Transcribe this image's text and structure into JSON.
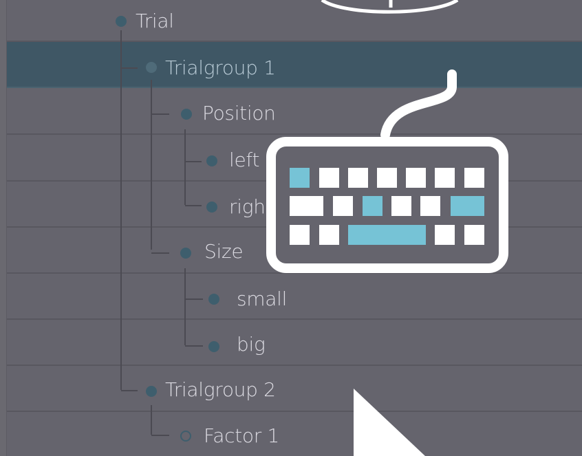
{
  "tree": {
    "nodes": [
      {
        "label": "Trial"
      },
      {
        "label": "Trialgroup 1"
      },
      {
        "label": "Position"
      },
      {
        "label": "left"
      },
      {
        "label": "righ"
      },
      {
        "label": "Size"
      },
      {
        "label": "small"
      },
      {
        "label": "big"
      },
      {
        "label": "Trialgroup 2"
      },
      {
        "label": "Factor 1"
      }
    ]
  },
  "overlay": {
    "icons": [
      "keyboard-icon",
      "mouse-pointer-icon",
      "circular-shape-icon"
    ]
  },
  "colors": {
    "background": "#65646d",
    "selected_row": "#3f5765",
    "node_dot": "#3e5e6d",
    "tree_text": "#dcdbe2",
    "key_accent": "#76c3d6",
    "overlay_white": "#ffffff"
  }
}
